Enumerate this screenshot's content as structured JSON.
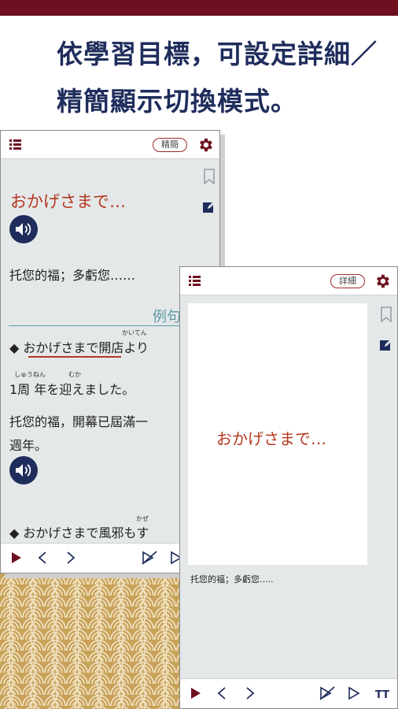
{
  "headline": {
    "line1": "依學習目標，可設定詳細／",
    "line2": "精簡顯示切換模式。"
  },
  "left_card": {
    "mode_label": "精簡",
    "word": "おかげさまで…",
    "meaning": "托您的福；多虧您……",
    "section_label": "例句",
    "example1": {
      "line1": "◆ おかげさまで開店より",
      "ruby1": "かいてん",
      "line2": "1周 年を迎えました。",
      "ruby2a": "しゅうねん",
      "ruby2b": "むか",
      "translation1": "托您的福，開幕已屆滿一",
      "translation2": "週年。"
    },
    "example2": {
      "line1": "◆ おかげさまで風邪もす",
      "ruby1": "かぜ"
    }
  },
  "right_card": {
    "mode_label": "詳細",
    "word": "おかげさまで…",
    "meaning": "托您的福；多虧您.....",
    "font_size_label": "TT"
  },
  "colors": {
    "brand": "#6e1020",
    "navy": "#1f2d5c",
    "word_red": "#b5381f",
    "teal": "#5d9aa5",
    "gold": "#c9a25a"
  },
  "icons": [
    "list-icon",
    "gear-icon",
    "bookmark-icon",
    "edit-icon",
    "speaker-icon",
    "play-icon",
    "prev-icon",
    "next-icon",
    "auto-play-icon",
    "font-size-icon"
  ]
}
